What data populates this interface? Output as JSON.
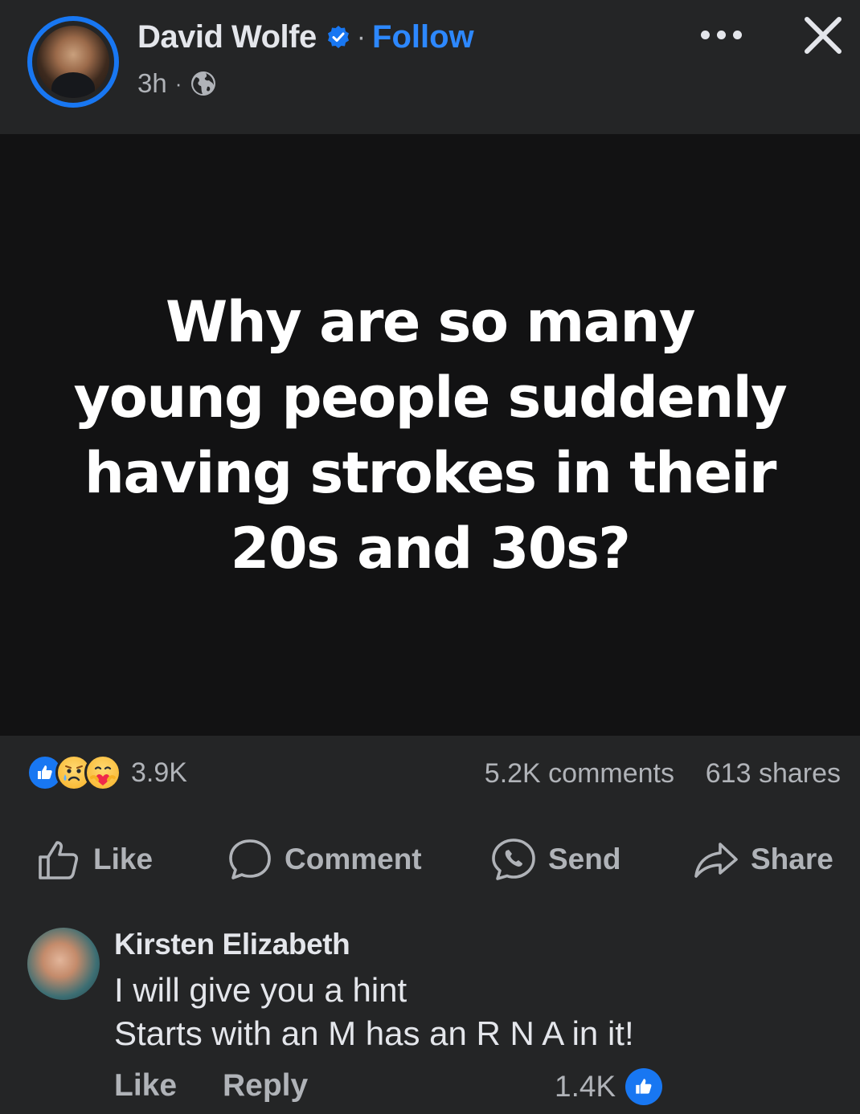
{
  "post": {
    "author": "David Wolfe",
    "follow_label": "Follow",
    "separator": "·",
    "time": "3h",
    "meta_separator": "·",
    "text": "Why are so many young people suddenly having strokes in their 20s and 30s?"
  },
  "stats": {
    "reactions_count": "3.9K",
    "comments": "5.2K comments",
    "shares": "613 shares"
  },
  "actions": {
    "like": "Like",
    "comment": "Comment",
    "send": "Send",
    "share": "Share"
  },
  "comment": {
    "author": "Kirsten Elizabeth",
    "line1": "I will give you a hint",
    "line2": "Starts with an M has an R N A in it!",
    "like": "Like",
    "reply": "Reply",
    "reactions_count": "1.4K"
  },
  "icons": {
    "verified": "verified-badge-icon",
    "globe": "globe-icon",
    "more": "more-icon",
    "close": "close-icon",
    "like": "thumbs-up-icon",
    "comment": "speech-bubble-icon",
    "send": "messenger-icon",
    "share": "share-arrow-icon"
  },
  "colors": {
    "background": "#242526",
    "media_background": "#121213",
    "accent": "#1877f2",
    "link": "#2d88ff",
    "primary_text": "#e4e6eb",
    "secondary_text": "#b0b3b8"
  }
}
